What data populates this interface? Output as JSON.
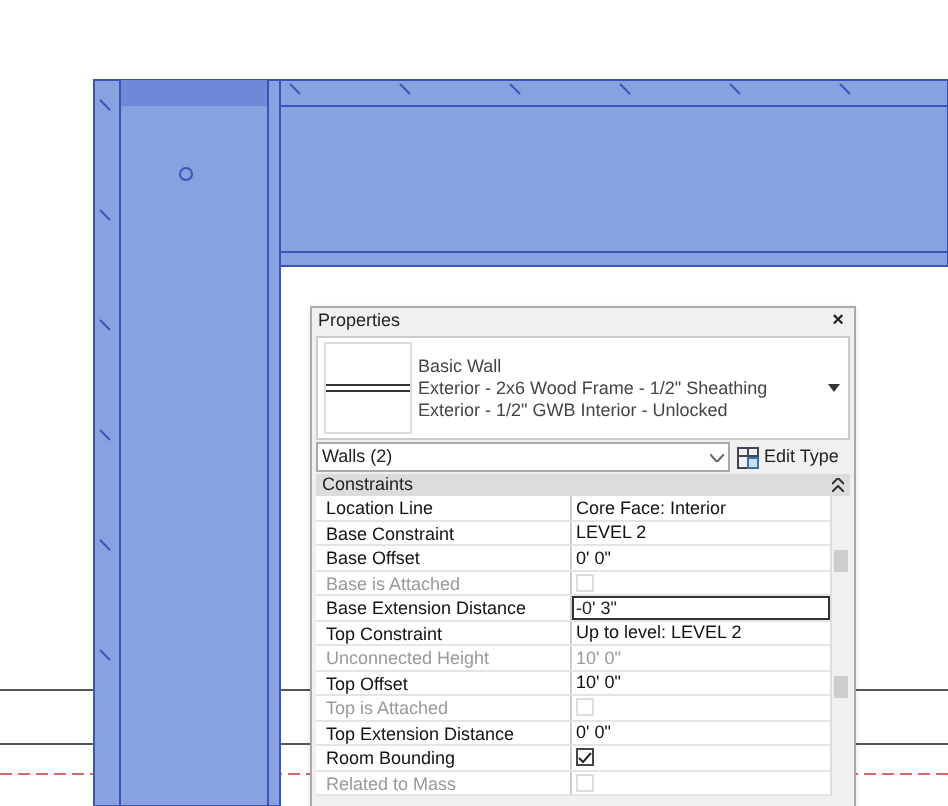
{
  "properties": {
    "title": "Properties",
    "close": "×",
    "type_selector": {
      "family": "Basic Wall",
      "type": "Exterior - 2x6 Wood Frame - 1/2\" Sheathing Exterior - 1/2\" GWB Interior - Unlocked"
    },
    "instance_filter": "Walls (2)",
    "edit_type": "Edit Type",
    "group": {
      "title": "Constraints",
      "expanded": true
    },
    "rows": [
      {
        "label": "Location Line",
        "kind": "text",
        "value": "Core Face: Interior",
        "disabled": false
      },
      {
        "label": "Base Constraint",
        "kind": "text",
        "value": "LEVEL 2",
        "disabled": false
      },
      {
        "label": "Base Offset",
        "kind": "text",
        "value": "0'  0\"",
        "disabled": false
      },
      {
        "label": "Base is Attached",
        "kind": "checkbox",
        "checked": false,
        "disabled": true
      },
      {
        "label": "Base Extension Distance",
        "kind": "input",
        "value": "-0'  3\"",
        "disabled": false
      },
      {
        "label": "Top Constraint",
        "kind": "text",
        "value": "Up to level: LEVEL 2",
        "disabled": false
      },
      {
        "label": "Unconnected Height",
        "kind": "text",
        "value": "10'  0\"",
        "disabled": true
      },
      {
        "label": "Top Offset",
        "kind": "text",
        "value": "10'  0\"",
        "disabled": false
      },
      {
        "label": "Top is Attached",
        "kind": "checkbox",
        "checked": false,
        "disabled": true
      },
      {
        "label": "Top Extension Distance",
        "kind": "text",
        "value": "0'  0\"",
        "disabled": false
      },
      {
        "label": "Room Bounding",
        "kind": "checkbox",
        "checked": true,
        "disabled": false
      },
      {
        "label": "Related to Mass",
        "kind": "checkbox",
        "checked": false,
        "disabled": true
      }
    ]
  }
}
